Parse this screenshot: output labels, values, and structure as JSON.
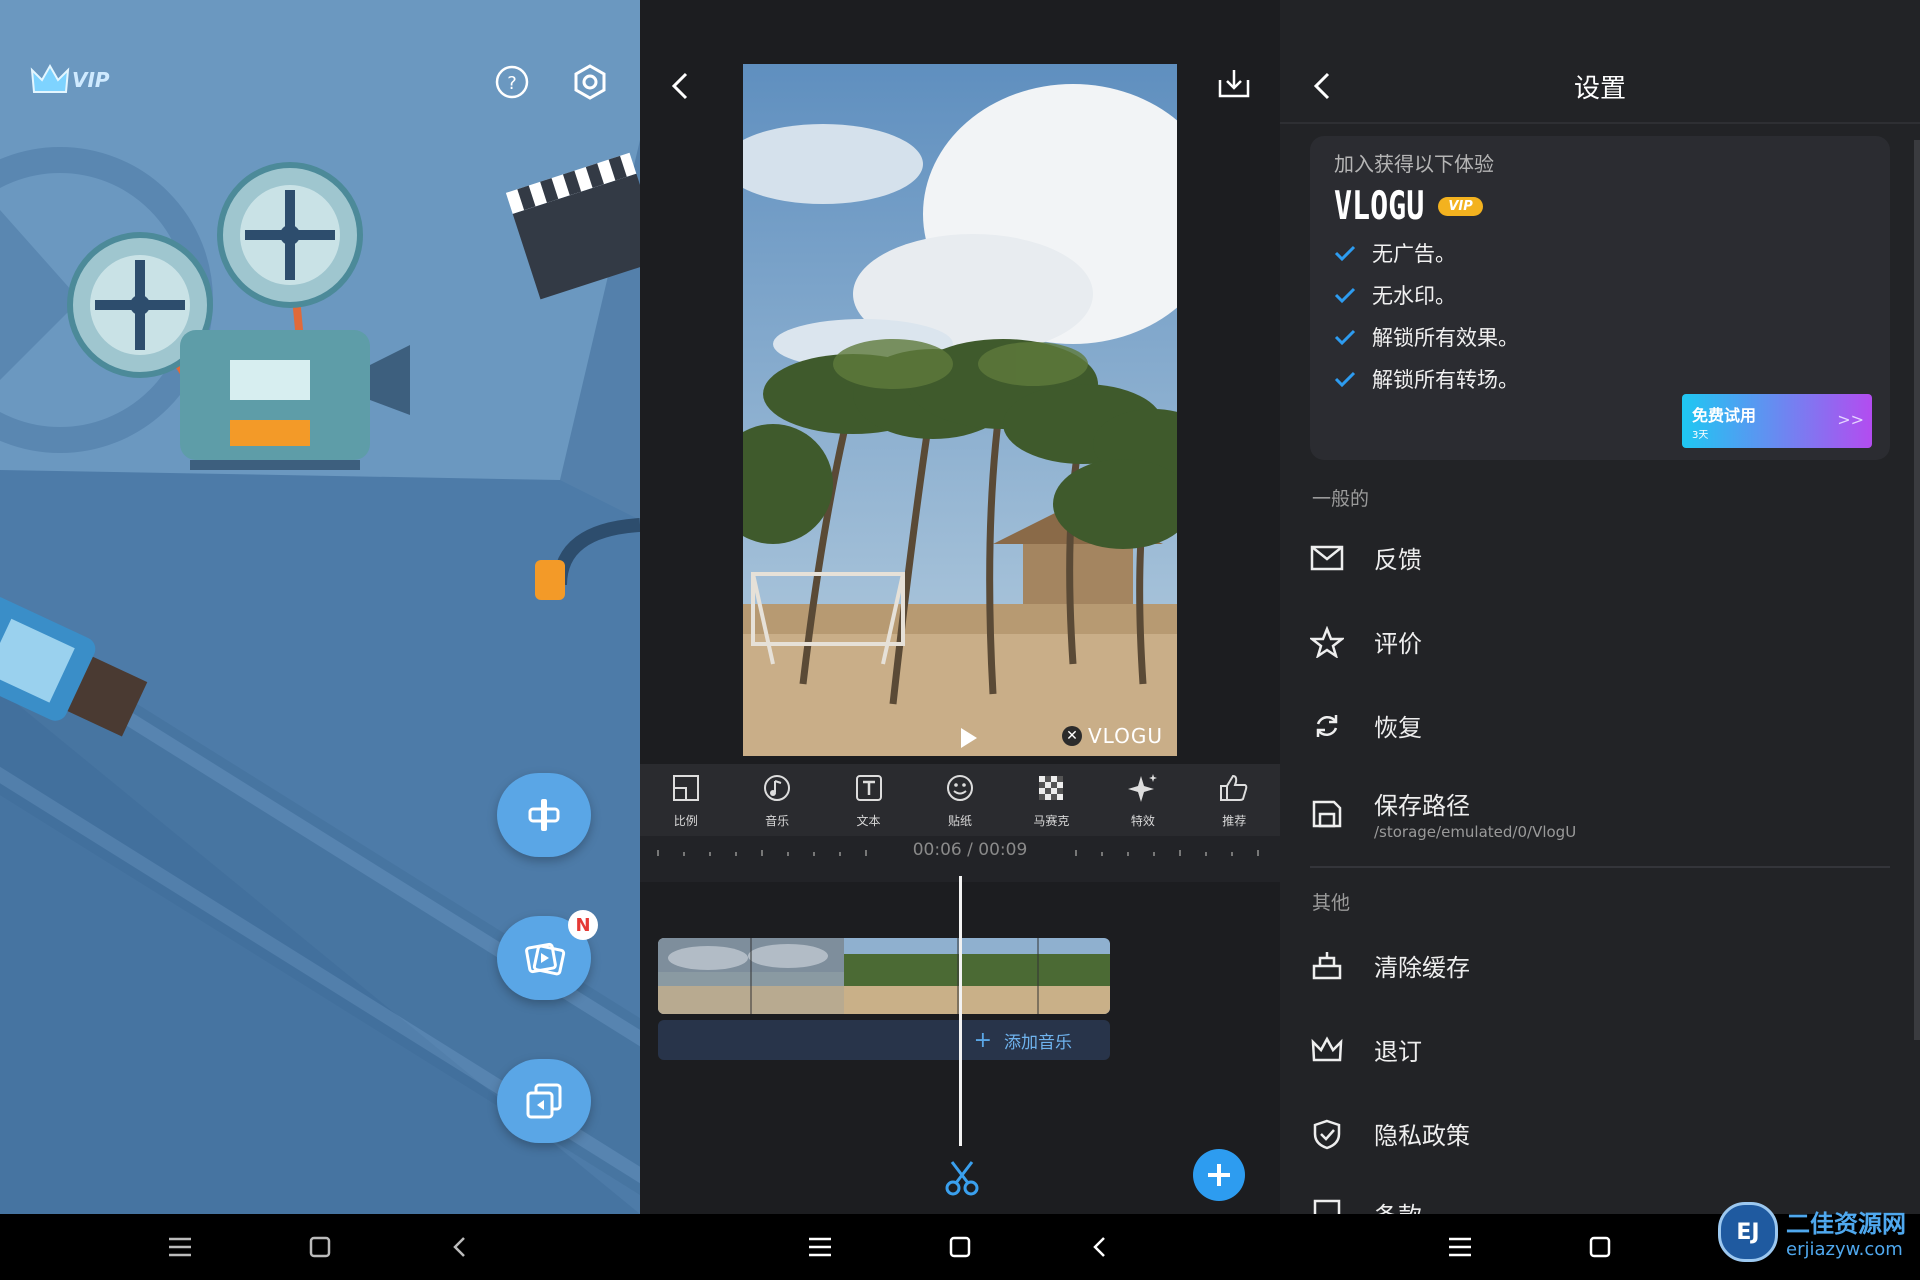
{
  "home": {
    "vip_label": "VIP",
    "fab_new_badge": "N"
  },
  "editor": {
    "watermark": "VLOGU",
    "tools": [
      {
        "label": "比例",
        "icon": "ratio-icon"
      },
      {
        "label": "音乐",
        "icon": "music-icon"
      },
      {
        "label": "文本",
        "icon": "text-icon"
      },
      {
        "label": "贴纸",
        "icon": "sticker-icon"
      },
      {
        "label": "马赛克",
        "icon": "mosaic-icon"
      },
      {
        "label": "特效",
        "icon": "sparkle-icon"
      },
      {
        "label": "推荐",
        "icon": "thumbs-up-icon"
      }
    ],
    "time_current": "00:06",
    "time_separator": "/",
    "time_total": "00:09",
    "add_music_label": "添加音乐",
    "add_music_plus": "+"
  },
  "settings": {
    "title": "设置",
    "promo": {
      "heading": "加入获得以下体验",
      "brand": "VLOGU",
      "brand_badge": "VIP",
      "benefits": [
        "无广告。",
        "无水印。",
        "解锁所有效果。",
        "解锁所有转场。"
      ],
      "trial_label": "免费试用",
      "trial_sub": "3天",
      "trial_arrow": ">>"
    },
    "section_general": "一般的",
    "feedback": "反馈",
    "rate": "评价",
    "restore": "恢复",
    "save_path_label": "保存路径",
    "save_path_value": "/storage/emulated/0/VlogU",
    "section_other": "其他",
    "clear_cache": "清除缓存",
    "unsubscribe": "退订",
    "privacy": "隐私政策",
    "terms_partial": "条款"
  },
  "watermark_site": {
    "logo": "EJ",
    "name": "二佳资源网",
    "url": "erjiazyw.com"
  },
  "colors": {
    "accent_blue": "#2d9cf0",
    "fab_blue": "#5aa6e6",
    "trial_gradient_start": "#1ec8f2",
    "trial_gradient_end": "#b34cf0"
  }
}
